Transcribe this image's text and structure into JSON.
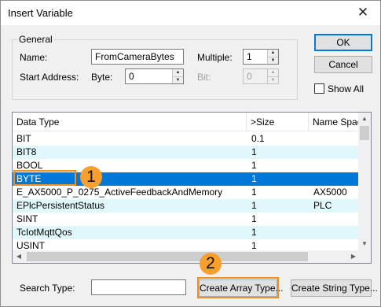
{
  "window": {
    "title": "Insert Variable",
    "close_glyph": "✕"
  },
  "general": {
    "legend": "General",
    "name_label": "Name:",
    "name_value": "FromCameraBytes",
    "multiple_label": "Multiple:",
    "multiple_value": "1",
    "start_address_label": "Start Address:",
    "byte_label": "Byte:",
    "byte_value": "0",
    "bit_label": "Bit:",
    "bit_value": "0"
  },
  "buttons": {
    "ok": "OK",
    "cancel": "Cancel",
    "show_all": "Show All"
  },
  "list": {
    "columns": [
      "Data Type",
      ">Size",
      "Name Spac"
    ],
    "rows": [
      {
        "type": "BIT",
        "size": "0.1",
        "ns": ""
      },
      {
        "type": "BIT8",
        "size": "1",
        "ns": ""
      },
      {
        "type": "BOOL",
        "size": "1",
        "ns": ""
      },
      {
        "type": "BYTE",
        "size": "1",
        "ns": ""
      },
      {
        "type": "E_AX5000_P_0275_ActiveFeedbackAndMemory",
        "size": "1",
        "ns": "AX5000"
      },
      {
        "type": "EPlcPersistentStatus",
        "size": "1",
        "ns": "PLC"
      },
      {
        "type": "SINT",
        "size": "1",
        "ns": ""
      },
      {
        "type": "TcIotMqttQos",
        "size": "1",
        "ns": ""
      },
      {
        "type": "USINT",
        "size": "1",
        "ns": ""
      }
    ],
    "selected_index": 3
  },
  "bottom": {
    "search_label": "Search Type:",
    "search_value": "",
    "create_array": "Create Array Type...",
    "create_string": "Create String Type..."
  },
  "annotations": {
    "badge1": "1",
    "badge2": "2",
    "color": "#f7a030"
  },
  "icons": {
    "spin_up": "▲",
    "spin_down": "▼",
    "scroll_up": "▲",
    "scroll_down": "▼",
    "scroll_left": "◀",
    "scroll_right": "▶"
  }
}
